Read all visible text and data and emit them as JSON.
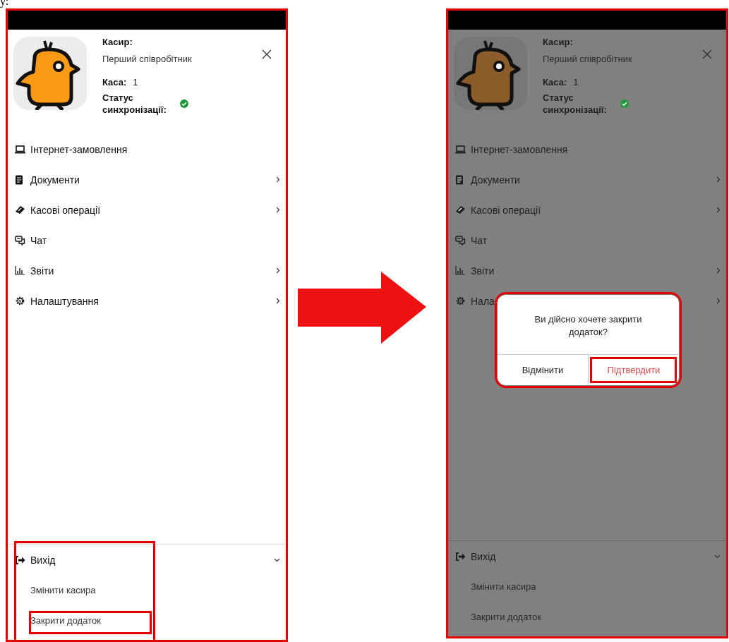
{
  "caption": "у:",
  "screens": [
    {
      "highlighted": true,
      "dimmed": false,
      "profile": {
        "cashier_label": "Касир:",
        "cashier_name": "Перший співробітник",
        "register_label": "Каса:",
        "register_value": "1",
        "sync_label": "Статус синхронізації:",
        "synced": true
      },
      "menu": [
        {
          "label": "Інтернет-замовлення",
          "chevron": false
        },
        {
          "label": "Документи",
          "chevron": true
        },
        {
          "label": "Касові операції",
          "chevron": true
        },
        {
          "label": "Чат",
          "chevron": false
        },
        {
          "label": "Звіти",
          "chevron": true
        },
        {
          "label": "Налаштування",
          "chevron": true
        }
      ],
      "exit": {
        "label": "Вихід",
        "expanded": true,
        "highlighted": true,
        "items": [
          {
            "label": "Змінити касира",
            "highlighted": false
          },
          {
            "label": "Закрити додаток",
            "highlighted": true
          }
        ]
      }
    },
    {
      "highlighted": true,
      "dimmed": true,
      "profile": {
        "cashier_label": "Касир:",
        "cashier_name": "Перший співробітник",
        "register_label": "Каса:",
        "register_value": "1",
        "sync_label": "Статус синхронізації:",
        "synced": true
      },
      "menu": [
        {
          "label": "Інтернет-замовлення",
          "chevron": false
        },
        {
          "label": "Документи",
          "chevron": true
        },
        {
          "label": "Касові операції",
          "chevron": true
        },
        {
          "label": "Чат",
          "chevron": false
        },
        {
          "label": "Звіти",
          "chevron": true
        },
        {
          "label": "Нала",
          "chevron": true
        }
      ],
      "exit": {
        "label": "Вихід",
        "expanded": true,
        "highlighted": false,
        "items": [
          {
            "label": "Змінити касира",
            "highlighted": false
          },
          {
            "label": "Закрити додаток",
            "highlighted": false
          }
        ]
      },
      "dialog": {
        "message": "Ви дійсно хочете закрити додаток?",
        "highlighted": true,
        "buttons": [
          {
            "label": "Відмінити",
            "kind": "cancel",
            "highlighted": false
          },
          {
            "label": "Підтвердити",
            "kind": "confirm",
            "highlighted": true
          }
        ]
      }
    }
  ]
}
